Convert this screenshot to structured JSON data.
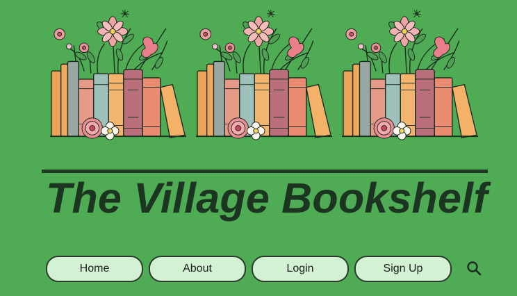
{
  "site": {
    "title": "The Village Bookshelf"
  },
  "nav": {
    "items": [
      {
        "label": "Home"
      },
      {
        "label": "About"
      },
      {
        "label": "Login"
      },
      {
        "label": "Sign Up"
      }
    ],
    "search_icon": "search-icon"
  },
  "banner": {
    "illustration": "books-with-flowers",
    "count": 3
  },
  "colors": {
    "background": "#4fab54",
    "title": "#1c3521",
    "button_fill": "#d3f2d4",
    "button_border": "#2b3a2d"
  }
}
